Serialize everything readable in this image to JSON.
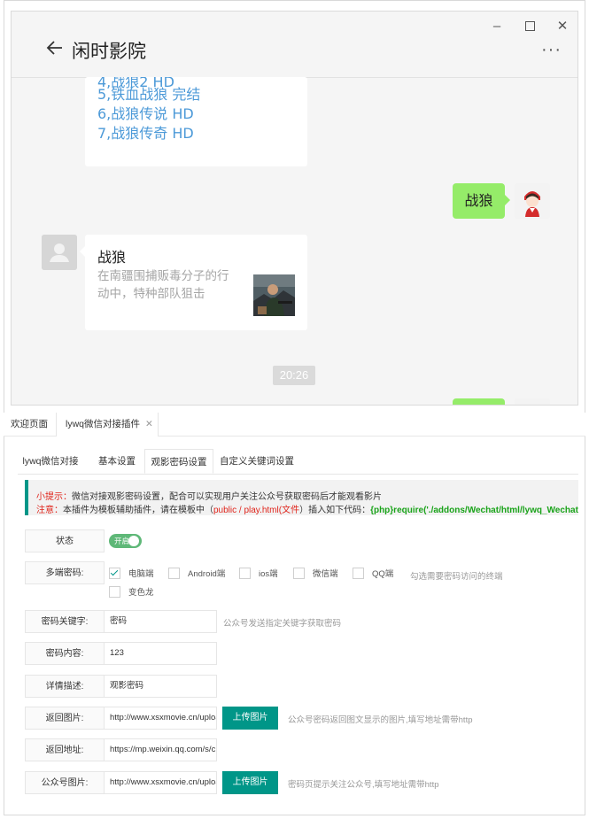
{
  "wechat": {
    "title": "闲时影院",
    "window_controls": {
      "minimize": "–",
      "close": "✕",
      "more": "···"
    },
    "list_card": {
      "partial_line": "4,战狼2 HD",
      "lines": [
        "5,铁血战狼 完结",
        "6,战狼传说 HD",
        "7,战狼传奇 HD"
      ]
    },
    "sent_message": "战狼",
    "article": {
      "title": "战狼",
      "description": "在南疆围捕贩毒分子的行动中，特种部队狙击"
    },
    "time": "20:26"
  },
  "admin": {
    "top_tabs": [
      {
        "label": "欢迎页面"
      },
      {
        "label": "lywq微信对接插件",
        "close": "✕"
      }
    ],
    "sub_tabs": [
      "lywq微信对接",
      "基本设置",
      "观影密码设置",
      "自定义关键词设置"
    ],
    "active_sub_tab": "观影密码设置",
    "tip": {
      "line1_prefix": "小提示：",
      "line1_text": "微信对接观影密码设置，配合可以实现用户关注公众号获取密码后才能观看影片",
      "line2_prefix": "注意：",
      "line2_text_a": "本插件为模板辅助插件，请在模板中（",
      "line2_file": "public / play.html(文件",
      "line2_text_b": "）插入如下代码：",
      "line2_code": "{php}require('./addons/Wechat/html/lywq_WechatPwd.ht"
    },
    "status": {
      "label": "状态",
      "switch_text": "开启",
      "on": true
    },
    "multi_device": {
      "label": "多端密码:",
      "options": [
        {
          "label": "电脑端",
          "checked": true
        },
        {
          "label": "Android端",
          "checked": false
        },
        {
          "label": "ios端",
          "checked": false
        },
        {
          "label": "微信端",
          "checked": false
        },
        {
          "label": "QQ端",
          "checked": false
        },
        {
          "label": "变色龙",
          "checked": false
        }
      ],
      "hint": "勾选需要密码访问的终端"
    },
    "keyword": {
      "label": "密码关键字:",
      "value": "密码",
      "hint": "公众号发送指定关键字获取密码"
    },
    "content": {
      "label": "密码内容:",
      "value": "123"
    },
    "detail": {
      "label": "详情描述:",
      "value": "观影密码"
    },
    "return_image": {
      "label": "返回图片:",
      "value": "http://www.xsxmovie.cn/uploa",
      "button": "上传图片",
      "hint": "公众号密码返回图文显示的图片,填写地址需带http"
    },
    "return_url": {
      "label": "返回地址:",
      "value": "https://mp.weixin.qq.com/s/cl"
    },
    "qr_image": {
      "label": "公众号图片:",
      "value": "http://www.xsxmovie.cn/uploa",
      "button": "上传图片",
      "hint": "密码页提示关注公众号,填写地址需带http"
    }
  },
  "colors": {
    "accent": "#009688",
    "bubble_green": "#95ec69",
    "link_blue": "#4d9ad8",
    "warn_red": "#e0251c",
    "code_green": "#1aa31a"
  }
}
